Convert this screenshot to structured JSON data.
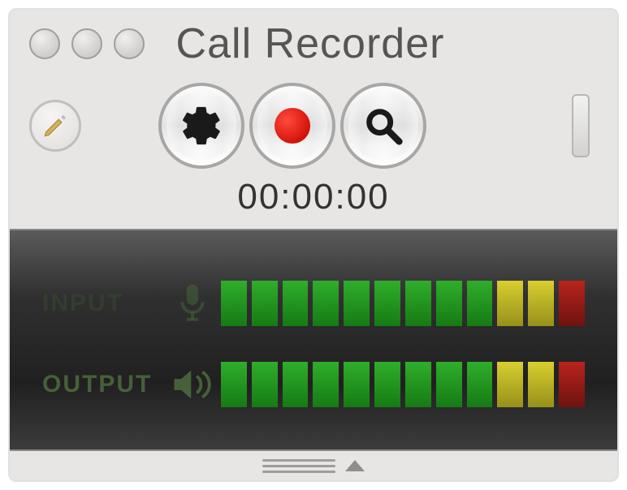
{
  "window": {
    "title": "Call Recorder"
  },
  "timer": "00:00:00",
  "buttons": {
    "pencil": "pencil-icon",
    "settings": "gear-icon",
    "record": "record-icon",
    "search": "search-icon"
  },
  "meters": {
    "input": {
      "label": "INPUT",
      "bars": [
        "green",
        "green",
        "green",
        "green",
        "green",
        "green",
        "green",
        "green",
        "green",
        "yellow",
        "yellow",
        "red"
      ]
    },
    "output": {
      "label": "OUTPUT",
      "bars": [
        "green",
        "green",
        "green",
        "green",
        "green",
        "green",
        "green",
        "green",
        "green",
        "yellow",
        "yellow",
        "red"
      ]
    }
  }
}
